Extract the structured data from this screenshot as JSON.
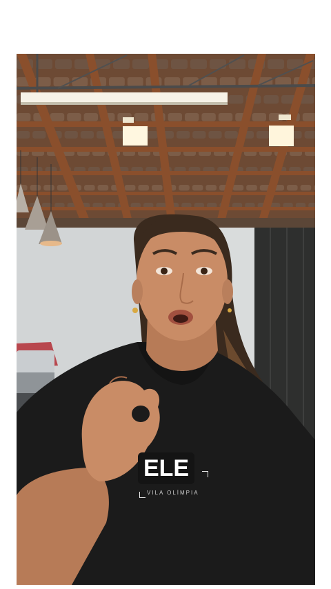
{
  "caption": {
    "text": "ELE"
  },
  "shirt_logo": {
    "subtext": "VILA OLÍMPIA"
  },
  "colors": {
    "background": "#ffffff",
    "ceiling_wood": "#8a4f2c",
    "shirt": "#1b1b1b",
    "wall": "#dcdfe0",
    "skin": "#c98c66",
    "hair": "#3a2a1e",
    "caption_bg": "#141414",
    "caption_text": "#ffffff"
  }
}
